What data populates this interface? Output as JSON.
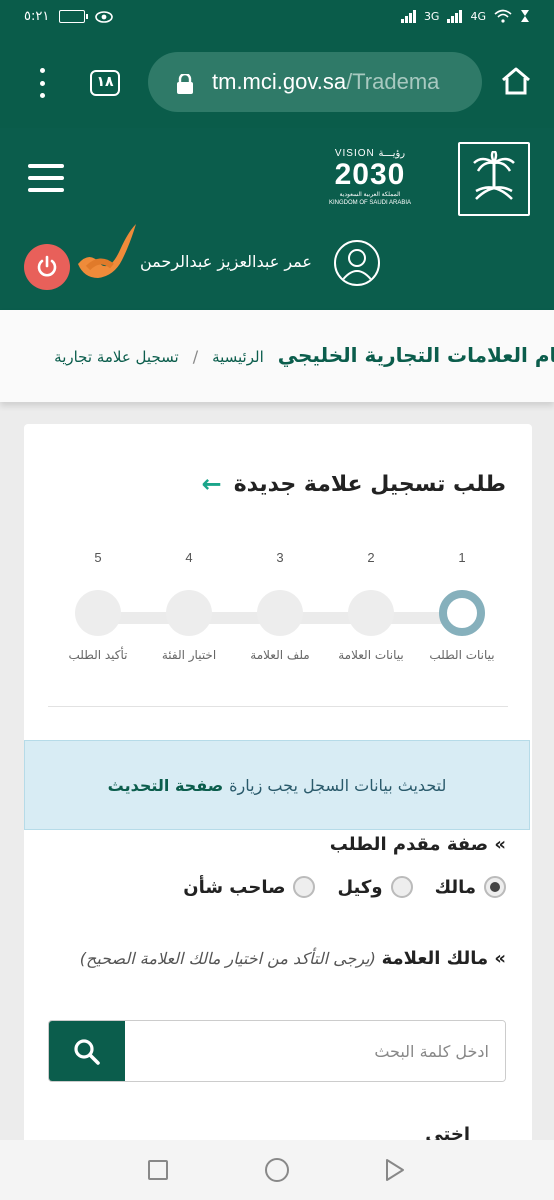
{
  "status_bar": {
    "time": "٥:٢١",
    "network_1": "4G",
    "network_2": "3G"
  },
  "browser": {
    "tab_count": "١٨",
    "url_main": "tm.mci.gov.sa",
    "url_faded": "/Tradema",
    "icons": [
      "menu-dots-icon",
      "tabs-icon",
      "lock-icon",
      "home-icon"
    ]
  },
  "header": {
    "vision_line1": "VISION رؤيـــة",
    "vision_year": "2030",
    "vision_line3": "المملكة العربية السعودية",
    "vision_line4": "KINGDOM OF SAUDI ARABIA",
    "user_name": "عمر عبدالعزيز عبدالرحمن",
    "colors": {
      "header_bg": "#0b5d4c",
      "power_btn": "#e8605a"
    }
  },
  "breadcrumb": {
    "site_title": "نظام العلامات التجارية الخليجي",
    "home": "الرئيسية",
    "separator": "/",
    "current": "تسجيل علامة تجارية"
  },
  "card": {
    "title": "طلب تسجيل علامة جديدة",
    "back_arrow": "←",
    "steps": [
      {
        "num": "1",
        "label": "بيانات الطلب",
        "active": true
      },
      {
        "num": "2",
        "label": "بيانات العلامة",
        "active": false
      },
      {
        "num": "3",
        "label": "ملف العلامة",
        "active": false
      },
      {
        "num": "4",
        "label": "اختيار الفئة",
        "active": false
      },
      {
        "num": "5",
        "label": "تأكيد الطلب",
        "active": false
      }
    ],
    "alert_text": "لتحديث بيانات السجل يجب زيارة",
    "alert_link": "صفحة التحديث",
    "applicant_heading": "» صفة مقدم الطلب",
    "radio_options": [
      {
        "label": "مالك",
        "checked": true
      },
      {
        "label": "وكيل",
        "checked": false
      },
      {
        "label": "صاحب شأن",
        "checked": false
      }
    ],
    "owner_heading": "» مالك العلامة",
    "owner_hint": "(يرجى التأكد من اختيار مالك العلامة الصحيح)",
    "search_placeholder": "ادخل كلمة البحث",
    "cutoff_text": "اختي"
  }
}
